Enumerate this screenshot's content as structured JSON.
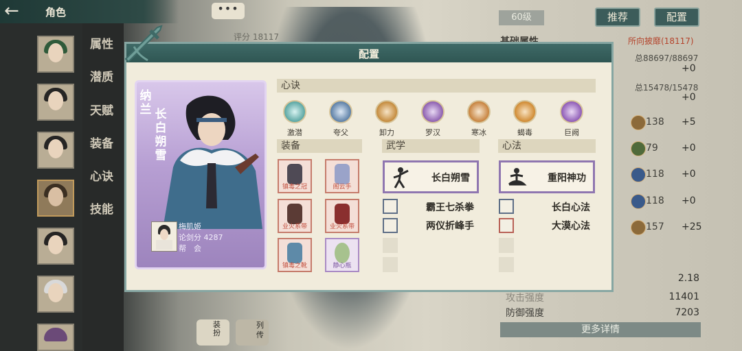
{
  "header": {
    "title": "角色"
  },
  "chat_bubble": "•••",
  "score_label": "评分 18117",
  "side_tabs": [
    "属性",
    "潜质",
    "天赋",
    "装备",
    "心诀",
    "技能"
  ],
  "right_panel": {
    "level": "60级",
    "buttons": {
      "recommend": "推荐",
      "config": "配置"
    },
    "basic_title": "基础属性",
    "source_link": "所向披靡(18117)",
    "totals": [
      {
        "total": "总88697/88697",
        "plus": "+0"
      },
      {
        "total": "总15478/15478",
        "plus": "+0"
      }
    ],
    "stats": [
      {
        "value": "138",
        "bonus": "+5"
      },
      {
        "value": "79",
        "bonus": "+0"
      },
      {
        "value": "118",
        "bonus": "+0"
      },
      {
        "value": "118",
        "bonus": "+0"
      },
      {
        "value": "157",
        "bonus": "+25"
      }
    ],
    "bottom": [
      {
        "label": "",
        "value": "2.18"
      },
      {
        "label": "攻击强度",
        "value": "11401"
      },
      {
        "label": "防御强度",
        "value": "7203"
      }
    ],
    "more_button": "更多详情"
  },
  "bottom_tabs": [
    "装扮",
    "列传"
  ],
  "dialog": {
    "title": "配置",
    "card": {
      "surname": "纳兰",
      "name": "长白朔雪",
      "player_name": "梅肌姬",
      "arena_score": "论剑分 4287",
      "guild": "帮　会"
    },
    "xinjue": {
      "header": "心诀",
      "skills": [
        {
          "name": "激潜",
          "color": "#5aa6a3"
        },
        {
          "name": "夸父",
          "color": "#5c7fa6"
        },
        {
          "name": "卸力",
          "color": "#c48a3c"
        },
        {
          "name": "罗汉",
          "color": "#8d5fb0"
        },
        {
          "name": "寒冰",
          "color": "#c7823d"
        },
        {
          "name": "蝎毒",
          "color": "#d08a32"
        },
        {
          "name": "巨阙",
          "color": "#8e5bb6"
        }
      ]
    },
    "equipment": {
      "header": "装备",
      "items": [
        {
          "name": "镇毒之冠",
          "art": "#4f4a55",
          "style": "red"
        },
        {
          "name": "阁云手",
          "art": "#9aa3c9",
          "style": "red"
        },
        {
          "name": "业火系带",
          "art": "#5b3b35",
          "style": "red"
        },
        {
          "name": "业火系带",
          "art": "#8a2f2f",
          "style": "red"
        },
        {
          "name": "镇毒之靴",
          "art": "#5e8aa8",
          "style": "red"
        },
        {
          "name": "静心瓶",
          "art": "#a7c28e",
          "style": "purple"
        }
      ]
    },
    "martial": {
      "header": "武学",
      "main": "长白朔雪",
      "subs": [
        "霸王七杀拳",
        "两仪折峰手"
      ]
    },
    "heart": {
      "header": "心法",
      "main": "重阳神功",
      "subs": [
        "长白心法",
        "大漠心法"
      ]
    }
  }
}
